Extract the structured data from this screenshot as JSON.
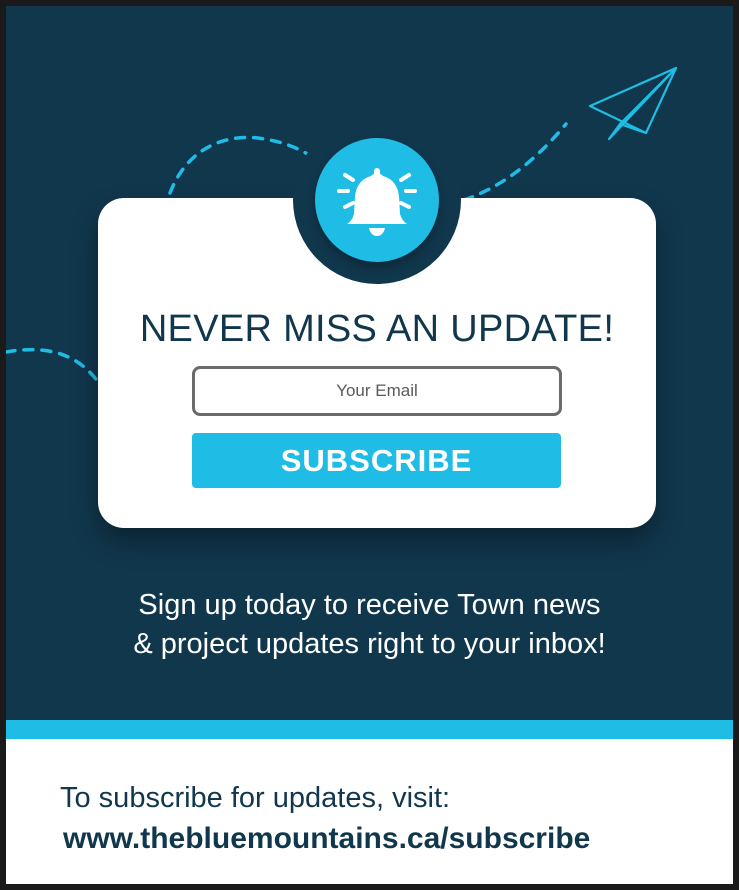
{
  "hero": {
    "title": "NEVER MISS AN UPDATE!",
    "email_placeholder": "Your Email",
    "subscribe_label": "SUBSCRIBE",
    "tagline_line1": "Sign up today to receive Town news",
    "tagline_line2": "& project updates right to your inbox!"
  },
  "footer": {
    "visit_label": "To subscribe for updates, visit:",
    "url": "www.thebluemountains.ca/subscribe"
  },
  "icons": [
    "bell-icon",
    "paper-plane-icon"
  ],
  "colors": {
    "navy": "#11374d",
    "accent_blue": "#1fbde6",
    "white": "#ffffff"
  }
}
